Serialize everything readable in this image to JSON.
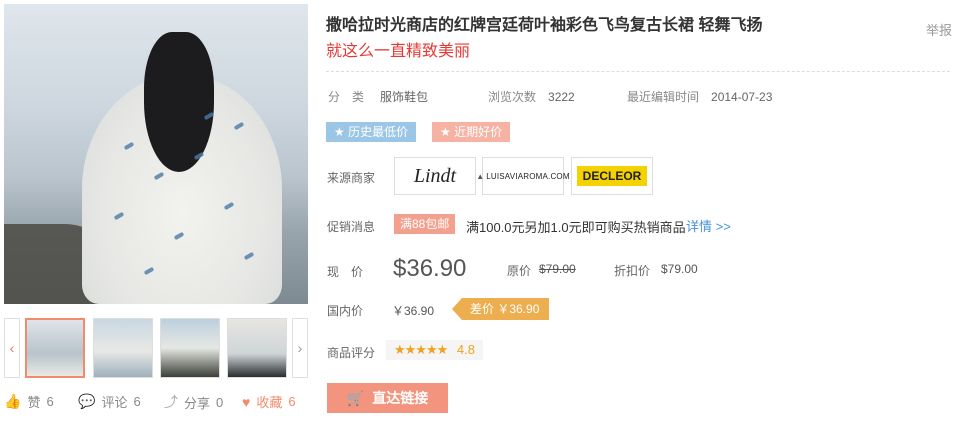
{
  "product": {
    "title": "撒哈拉时光商店的红牌宫廷荷叶袖彩色飞鸟复古长裙 轻舞飞扬",
    "subtitle": "就这么一直精致美丽",
    "report": "举报"
  },
  "meta": {
    "category_key": "分　类",
    "category_value": "服饰鞋包",
    "views_key": "浏览次数",
    "views_value": "3222",
    "edited_key": "最近编辑时间",
    "edited_value": "2014-07-23"
  },
  "tags": {
    "lowest": "历史最低价",
    "good": "近期好价",
    "star_icon": "★"
  },
  "merchants": {
    "label": "来源商家",
    "items": [
      {
        "name": "Lindt"
      },
      {
        "name": "LUISAVIAROMA.COM"
      },
      {
        "name": "DECLEOR"
      }
    ]
  },
  "promo": {
    "label": "促销消息",
    "badge": "满88包邮",
    "text": "满100.0元另加1.0元即可购买热销商品",
    "detail": "详情 >>"
  },
  "price": {
    "now_label": "现　价",
    "now_value": "$36.90",
    "original_label": "原价",
    "original_value": "$79.00",
    "discount_label": "折扣价",
    "discount_value": "$79.00",
    "domestic_label": "国内价",
    "domestic_value": "￥36.90",
    "diff_text": "差价 ￥36.90"
  },
  "rating": {
    "label": "商品评分",
    "stars": "★★★★★",
    "score": "4.8",
    "value": 4.8
  },
  "buy": {
    "label": "直达链接",
    "cart_icon": "🛒"
  },
  "social": {
    "like_label": "赞",
    "like_count": "6",
    "comment_label": "评论",
    "comment_count": "6",
    "share_label": "分享",
    "share_count": "0",
    "fav_label": "收藏",
    "fav_count": "6"
  },
  "gallery": {
    "prev": "‹",
    "next": "›",
    "thumb_colors": [
      "#d8dde0",
      "#c2cfd8",
      "#b9c5cc",
      "#d0d3cf"
    ]
  }
}
